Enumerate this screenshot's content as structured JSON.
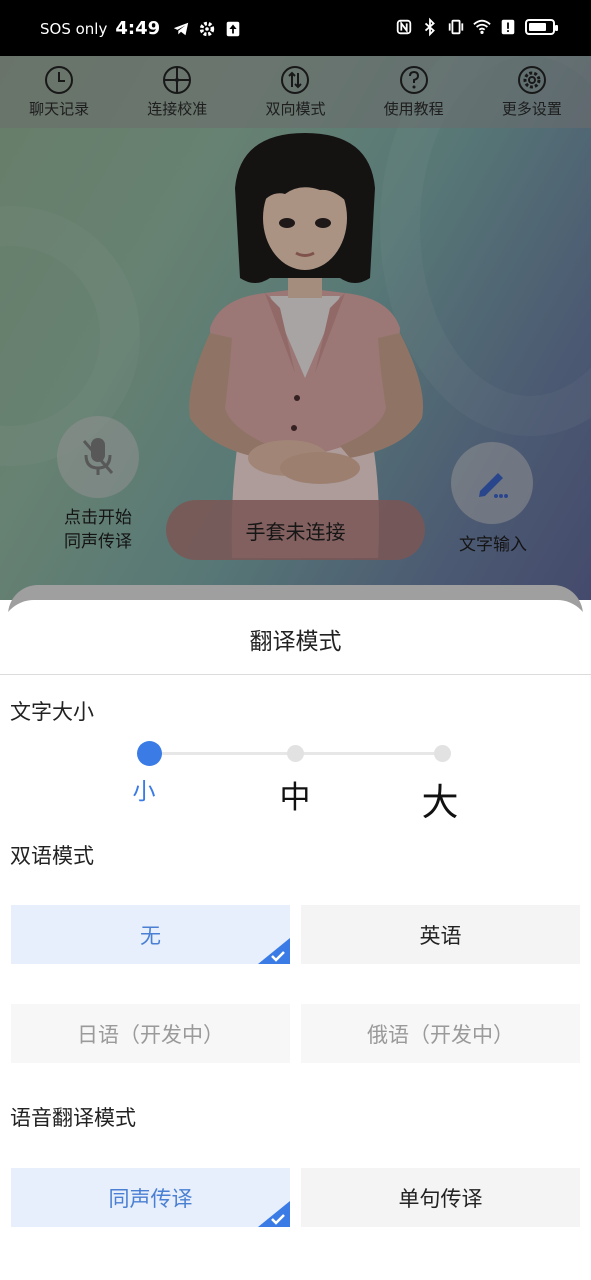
{
  "status_bar": {
    "carrier": "SOS only",
    "time": "4:49",
    "battery_level": 0.75
  },
  "toolbar": {
    "items": [
      {
        "label": "聊天记录",
        "icon": "clock-icon"
      },
      {
        "label": "连接校准",
        "icon": "crosshair-icon"
      },
      {
        "label": "双向模式",
        "icon": "swap-icon"
      },
      {
        "label": "使用教程",
        "icon": "help-icon"
      },
      {
        "label": "更多设置",
        "icon": "gear-icon"
      }
    ]
  },
  "scene": {
    "mic_label_line1": "点击开始",
    "mic_label_line2": "同声传译",
    "glove_status": "手套未连接",
    "text_input_label": "文字输入"
  },
  "sheet": {
    "title": "翻译模式",
    "font_size": {
      "label": "文字大小",
      "options": [
        "小",
        "中",
        "大"
      ],
      "selected_index": 0
    },
    "bilingual": {
      "label": "双语模式",
      "options": [
        {
          "label": "无",
          "state": "selected"
        },
        {
          "label": "英语",
          "state": "normal"
        },
        {
          "label": "日语（开发中）",
          "state": "disabled"
        },
        {
          "label": "俄语（开发中）",
          "state": "disabled"
        }
      ]
    },
    "voice": {
      "label": "语音翻译模式",
      "options": [
        {
          "label": "同声传译",
          "state": "selected"
        },
        {
          "label": "单句传译",
          "state": "normal"
        }
      ]
    }
  },
  "colors": {
    "accent": "#3a7be6",
    "selected_bg": "#e6effb",
    "glove_button": "#aa7876"
  }
}
